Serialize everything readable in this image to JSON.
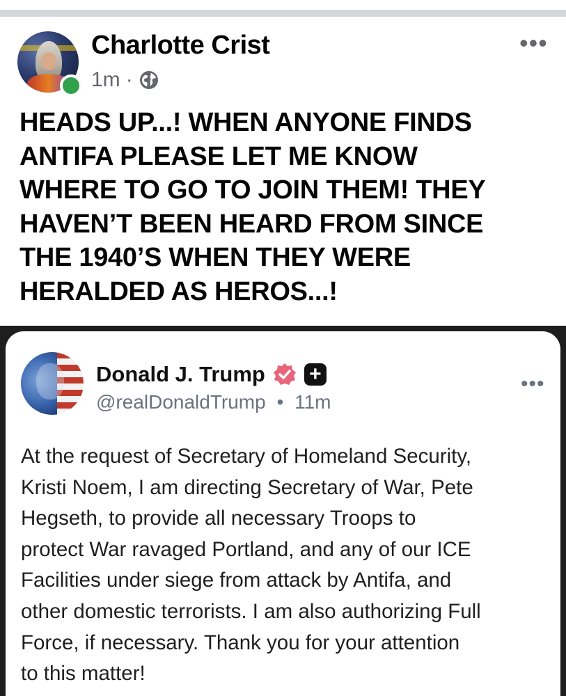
{
  "post": {
    "author_name": "Charlotte Crist",
    "timestamp": "1m",
    "separator": "·",
    "privacy_icon": "globe-icon",
    "more_icon": "•••",
    "status": "online",
    "text": "HEADS UP...!  WHEN ANYONE FINDS\nANTIFA PLEASE LET ME KNOW\nWHERE TO GO TO JOIN THEM!  THEY\nHAVEN’T BEEN HEARD FROM SINCE\nTHE 1940’S WHEN THEY WERE\nHERALDED AS HEROS...!"
  },
  "embedded_post": {
    "author_name": "Donald J. Trump",
    "verified_icon": "verified-badge-icon",
    "plus_icon": "+",
    "handle": "@realDonaldTrump",
    "handle_separator": "•",
    "timestamp": "11m",
    "more_icon": "•••",
    "text": "At the request of Secretary of Homeland Security,\nKristi Noem, I am directing Secretary of War, Pete\nHegseth, to provide all necessary Troops to\nprotect War ravaged Portland, and any of our ICE\nFacilities under siege from attack by Antifa, and\nother domestic terrorists. I am also authorizing Full\nForce, if necessary. Thank you for your attention\nto this matter!"
  },
  "colors": {
    "online": "#31a24c",
    "verified_badge": "#e8657a",
    "meta_text": "#65676b"
  }
}
